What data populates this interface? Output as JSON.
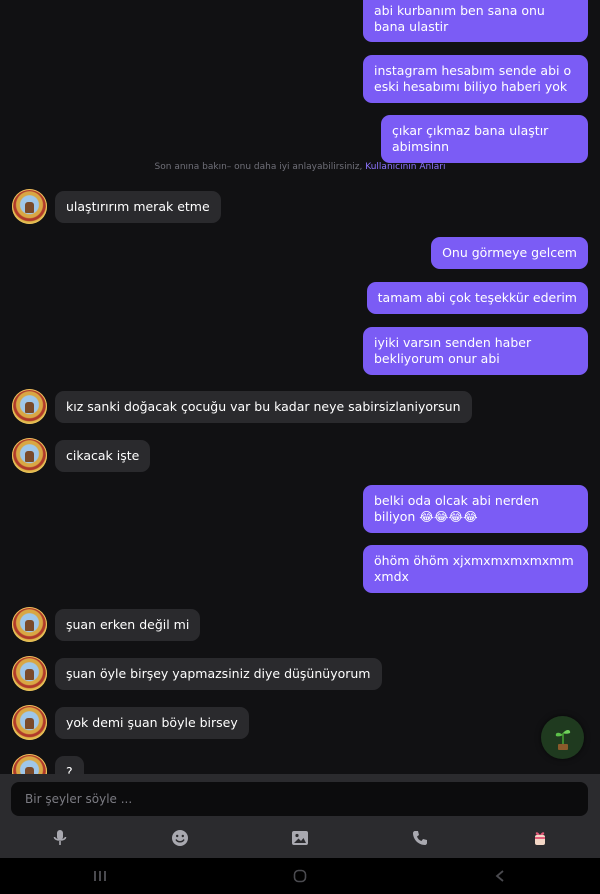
{
  "system_notice": {
    "text": "Son anına bakın– onu daha iyi anlayabilirsiniz,",
    "link": "Kullanıcının Anları"
  },
  "messages": [
    {
      "side": "out",
      "text": "abi kurbanım ben sana onu bana ulastir"
    },
    {
      "side": "out",
      "text": "instagram hesabım sende abi o eski hesabımı biliyo haberi yok"
    },
    {
      "side": "out",
      "text": "çıkar çıkmaz bana ulaştır abimsinn"
    },
    {
      "side": "in",
      "text": "ulaştırırım merak etme"
    },
    {
      "side": "out",
      "text": "Onu görmeye gelcem"
    },
    {
      "side": "out",
      "text": "tamam abi çok teşekkür ederim"
    },
    {
      "side": "out",
      "text": "iyiki varsın senden haber bekliyorum onur abi"
    },
    {
      "side": "in",
      "text": "kız sanki doğacak çocuğu var bu kadar neye sabirsizlaniyorsun"
    },
    {
      "side": "in",
      "text": "cikacak işte"
    },
    {
      "side": "out",
      "text": "belki oda olcak abi nerden biliyon 😂😂😂😂"
    },
    {
      "side": "out",
      "text": "öhöm öhöm xjxmxmxmxmxmmxmdx"
    },
    {
      "side": "in",
      "text": "şuan erken değil mi"
    },
    {
      "side": "in",
      "text": "şuan öyle birşey yapmazsiniz diye düşünüyorum"
    },
    {
      "side": "in",
      "text": "yok demi şuan böyle birsey"
    },
    {
      "side": "in",
      "text": "?"
    }
  ],
  "composer": {
    "placeholder": "Bir şeyler söyle ...",
    "tools": [
      "microphone-icon",
      "emoji-icon",
      "image-icon",
      "phone-icon",
      "gift-icon"
    ]
  },
  "colors": {
    "background": "#111113",
    "outgoing_bubble": "#7b5cf5",
    "incoming_bubble": "#2a2a2d",
    "link": "#8d74ff"
  }
}
